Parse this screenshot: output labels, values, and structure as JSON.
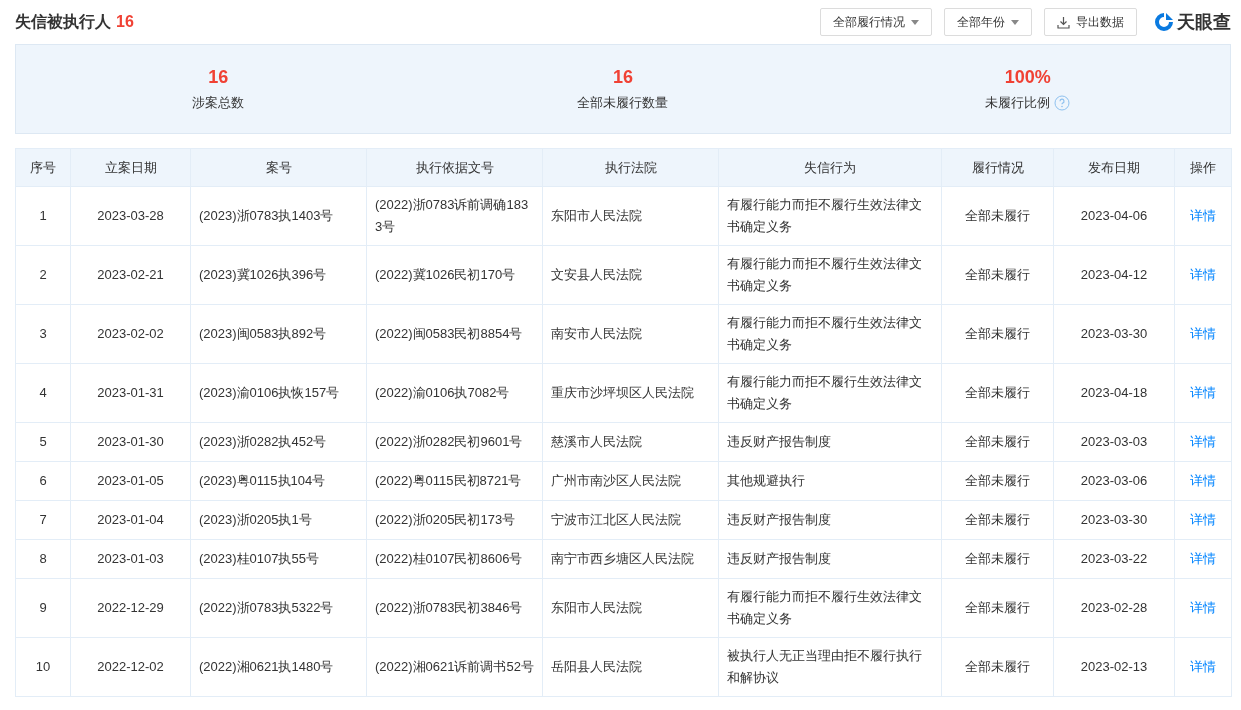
{
  "header": {
    "title": "失信被执行人",
    "count": "16",
    "filters": [
      {
        "label": "全部履行情况"
      },
      {
        "label": "全部年份"
      }
    ],
    "export": "导出数据",
    "logo": "天眼查"
  },
  "summary": [
    {
      "value": "16",
      "label": "涉案总数",
      "help": false
    },
    {
      "value": "16",
      "label": "全部未履行数量",
      "help": false
    },
    {
      "value": "100%",
      "label": "未履行比例",
      "help": true
    }
  ],
  "table": {
    "columns": [
      "序号",
      "立案日期",
      "案号",
      "执行依据文号",
      "执行法院",
      "失信行为",
      "履行情况",
      "发布日期",
      "操作"
    ],
    "rows": [
      [
        "1",
        "2023-03-28",
        "(2023)浙0783执1403号",
        "(2022)浙0783诉前调确1833号",
        "东阳市人民法院",
        "有履行能力而拒不履行生效法律文书确定义务",
        "全部未履行",
        "2023-04-06",
        "详情"
      ],
      [
        "2",
        "2023-02-21",
        "(2023)冀1026执396号",
        "(2022)冀1026民初170号",
        "文安县人民法院",
        "有履行能力而拒不履行生效法律文书确定义务",
        "全部未履行",
        "2023-04-12",
        "详情"
      ],
      [
        "3",
        "2023-02-02",
        "(2023)闽0583执892号",
        "(2022)闽0583民初8854号",
        "南安市人民法院",
        "有履行能力而拒不履行生效法律文书确定义务",
        "全部未履行",
        "2023-03-30",
        "详情"
      ],
      [
        "4",
        "2023-01-31",
        "(2023)渝0106执恢157号",
        "(2022)渝0106执7082号",
        "重庆市沙坪坝区人民法院",
        "有履行能力而拒不履行生效法律文书确定义务",
        "全部未履行",
        "2023-04-18",
        "详情"
      ],
      [
        "5",
        "2023-01-30",
        "(2023)浙0282执452号",
        "(2022)浙0282民初9601号",
        "慈溪市人民法院",
        "违反财产报告制度",
        "全部未履行",
        "2023-03-03",
        "详情"
      ],
      [
        "6",
        "2023-01-05",
        "(2023)粤0115执104号",
        "(2022)粤0115民初8721号",
        "广州市南沙区人民法院",
        "其他规避执行",
        "全部未履行",
        "2023-03-06",
        "详情"
      ],
      [
        "7",
        "2023-01-04",
        "(2023)浙0205执1号",
        "(2022)浙0205民初173号",
        "宁波市江北区人民法院",
        "违反财产报告制度",
        "全部未履行",
        "2023-03-30",
        "详情"
      ],
      [
        "8",
        "2023-01-03",
        "(2023)桂0107执55号",
        "(2022)桂0107民初8606号",
        "南宁市西乡塘区人民法院",
        "违反财产报告制度",
        "全部未履行",
        "2023-03-22",
        "详情"
      ],
      [
        "9",
        "2022-12-29",
        "(2022)浙0783执5322号",
        "(2022)浙0783民初3846号",
        "东阳市人民法院",
        "有履行能力而拒不履行生效法律文书确定义务",
        "全部未履行",
        "2023-02-28",
        "详情"
      ],
      [
        "10",
        "2022-12-02",
        "(2022)湘0621执1480号",
        "(2022)湘0621诉前调书52号",
        "岳阳县人民法院",
        "被执行人无正当理由拒不履行执行和解协议",
        "全部未履行",
        "2023-02-13",
        "详情"
      ]
    ]
  }
}
